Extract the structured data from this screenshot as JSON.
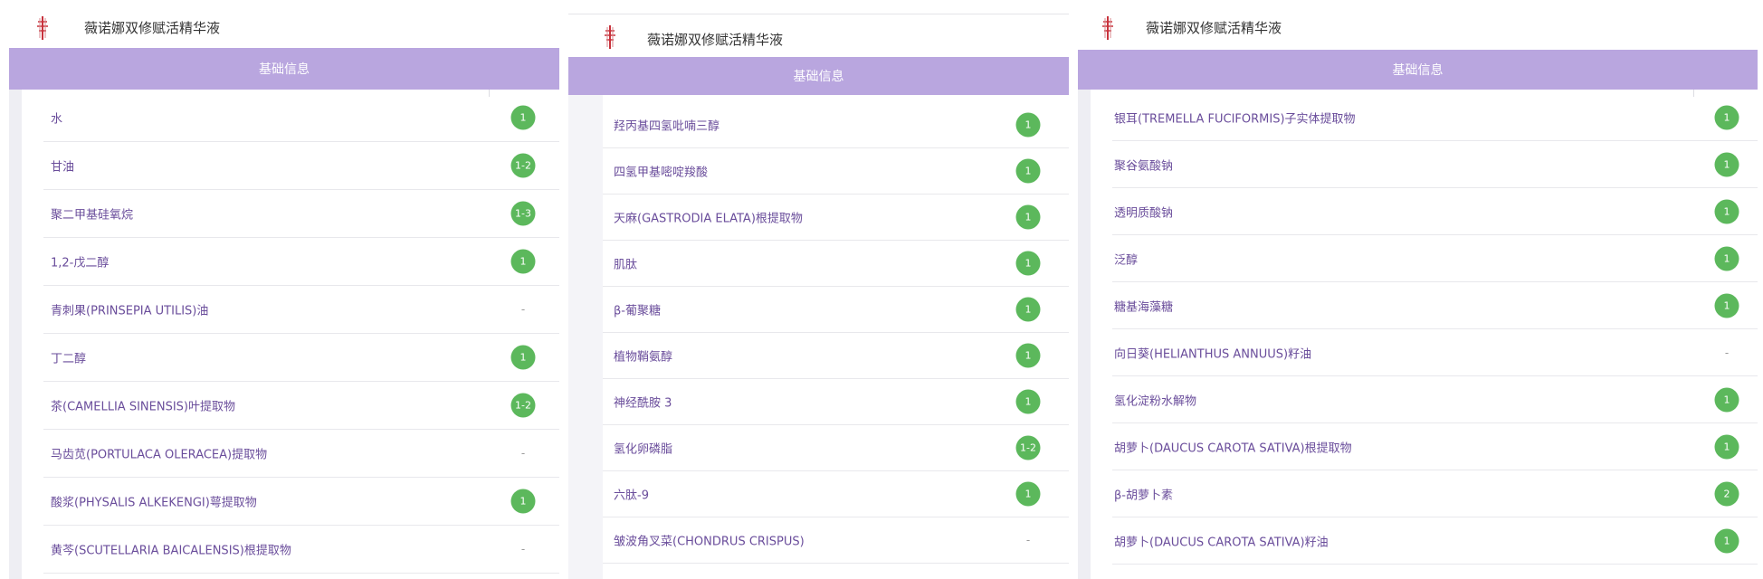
{
  "colors": {
    "section_bar": "#b9a6df",
    "badge": "#5cb85c",
    "item_text": "#6a4d9b"
  },
  "panels": [
    {
      "product_name": "薇诺娜双修赋活精华液",
      "section_title": "基础信息",
      "items": [
        {
          "name": "水",
          "score": "1"
        },
        {
          "name": "甘油",
          "score": "1-2"
        },
        {
          "name": "聚二甲基硅氧烷",
          "score": "1-3"
        },
        {
          "name": "1,2-戊二醇",
          "score": "1"
        },
        {
          "name": "青刺果(PRINSEPIA UTILIS)油",
          "score": "-"
        },
        {
          "name": "丁二醇",
          "score": "1"
        },
        {
          "name": "茶(CAMELLIA SINENSIS)叶提取物",
          "score": "1-2"
        },
        {
          "name": "马齿苋(PORTULACA OLERACEA)提取物",
          "score": "-"
        },
        {
          "name": "酸浆(PHYSALIS ALKEKENGI)萼提取物",
          "score": "1"
        },
        {
          "name": "黄芩(SCUTELLARIA BAICALENSIS)根提取物",
          "score": "-"
        }
      ]
    },
    {
      "product_name": "薇诺娜双修赋活精华液",
      "section_title": "基础信息",
      "items": [
        {
          "name": "羟丙基四氢吡喃三醇",
          "score": "1"
        },
        {
          "name": "四氢甲基嘧啶羧酸",
          "score": "1"
        },
        {
          "name": "天麻(GASTRODIA ELATA)根提取物",
          "score": "1"
        },
        {
          "name": "肌肽",
          "score": "1"
        },
        {
          "name": "β-葡聚糖",
          "score": "1"
        },
        {
          "name": "植物鞘氨醇",
          "score": "1"
        },
        {
          "name": "神经酰胺 3",
          "score": "1"
        },
        {
          "name": "氢化卵磷脂",
          "score": "1-2"
        },
        {
          "name": "六肽-9",
          "score": "1"
        },
        {
          "name": "皱波角叉菜(CHONDRUS CRISPUS)",
          "score": "-"
        }
      ]
    },
    {
      "product_name": "薇诺娜双修赋活精华液",
      "section_title": "基础信息",
      "items": [
        {
          "name": "银耳(TREMELLA FUCIFORMIS)子实体提取物",
          "score": "1"
        },
        {
          "name": "聚谷氨酸钠",
          "score": "1"
        },
        {
          "name": "透明质酸钠",
          "score": "1"
        },
        {
          "name": "泛醇",
          "score": "1"
        },
        {
          "name": "糖基海藻糖",
          "score": "1"
        },
        {
          "name": "向日葵(HELIANTHUS ANNUUS)籽油",
          "score": "-"
        },
        {
          "name": "氢化淀粉水解物",
          "score": "1"
        },
        {
          "name": "胡萝卜(DAUCUS CAROTA SATIVA)根提取物",
          "score": "1"
        },
        {
          "name": "β-胡萝卜素",
          "score": "2"
        },
        {
          "name": "胡萝卜(DAUCUS CAROTA SATIVA)籽油",
          "score": "1"
        }
      ]
    }
  ]
}
